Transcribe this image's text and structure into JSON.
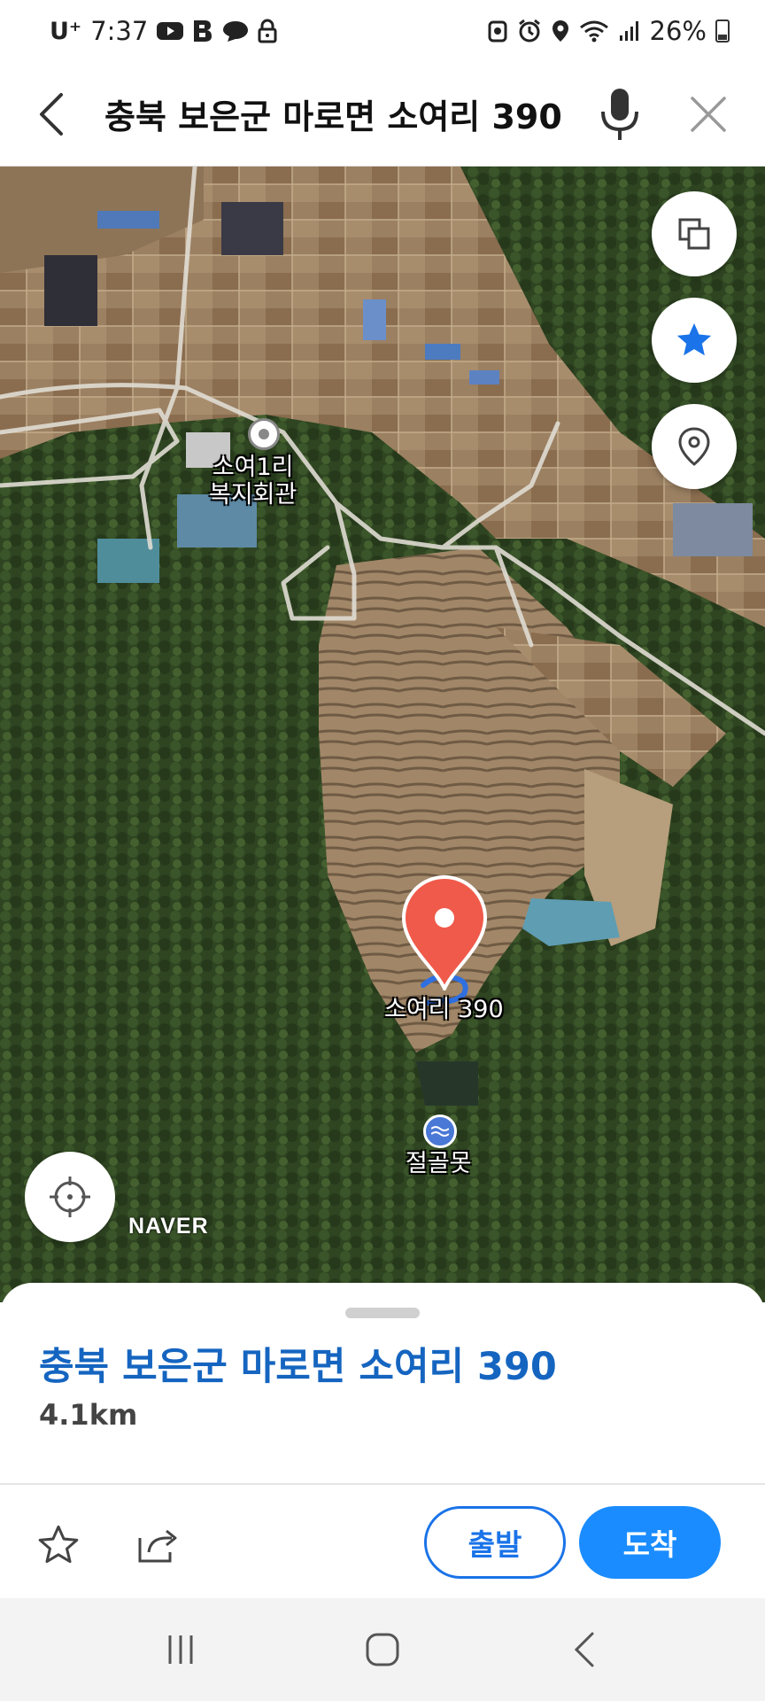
{
  "status_bar": {
    "carrier": "U⁺",
    "time": "7:37",
    "battery": "26%",
    "icons": [
      "youtube-icon",
      "b-app-icon",
      "chat-icon",
      "lock-icon",
      "android-icon",
      "alarm-icon",
      "location-icon",
      "wifi-icon",
      "signal-icon",
      "battery-icon"
    ]
  },
  "search": {
    "query": "충북 보은군 마로면 소여리 390",
    "icons": [
      "back-arrow-icon",
      "microphone-icon",
      "close-icon"
    ]
  },
  "map": {
    "labels": {
      "welfare_center": "소여1리\n복지회관",
      "pin_label": "소여리 390",
      "pond": "절골못"
    },
    "logo": "NAVER",
    "controls": [
      "layers-icon",
      "star-icon",
      "location-marker-icon",
      "crosshair-icon"
    ],
    "colors": {
      "pin": "#f05a4a",
      "route": "#2f6fe0"
    }
  },
  "place": {
    "name": "충북 보은군 마로면 소여리 390",
    "distance": "4.1km",
    "depart_label": "출발",
    "arrive_label": "도착"
  },
  "nav": {
    "icons": [
      "recent-apps-icon",
      "home-icon",
      "back-icon"
    ]
  },
  "colors": {
    "accent": "#1a73e8",
    "title_blue": "#1565c0",
    "arrive_fill": "#1a8cff"
  }
}
